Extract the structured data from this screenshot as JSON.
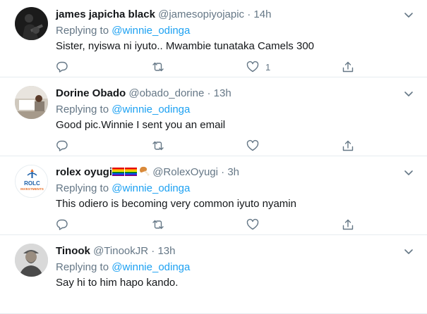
{
  "tweets": [
    {
      "name": "james japicha black",
      "handle": "@jamesopiyojapic",
      "separator": "·",
      "time": "14h",
      "replying_prefix": "Replying to",
      "replying_to": "@winnie_odinga",
      "text": "Sister, nyiswa ni iyuto.. Mwambie tunataka Camels 300",
      "like_count": "1",
      "avatar": "dark-guitar-photo"
    },
    {
      "name": "Dorine Obado",
      "handle": "@obado_dorine",
      "separator": "·",
      "time": "13h",
      "replying_prefix": "Replying to",
      "replying_to": "@winnie_odinga",
      "text": "Good pic.Winnie I sent you an email",
      "like_count": "",
      "avatar": "office-photo"
    },
    {
      "name": "rolex oyugi",
      "handle": "@RolexOyugi",
      "separator": "·",
      "time": "3h",
      "replying_prefix": "Replying to",
      "replying_to": "@winnie_odinga",
      "text": "This odiero is becoming very common iyuto nyamin",
      "like_count": "",
      "avatar": "rolc-logo",
      "avatar_text": [
        "ROLC",
        "INVESTMENTS"
      ]
    },
    {
      "name": "Tinook",
      "handle": "@TinookJR",
      "separator": "·",
      "time": "13h",
      "replying_prefix": "Replying to",
      "replying_to": "@winnie_odinga",
      "text": "Say hi to him hapo kando.",
      "like_count": "",
      "avatar": "man-portrait-photo"
    }
  ],
  "icons": {
    "reply": "reply-icon",
    "retweet": "retweet-icon",
    "like": "heart-icon",
    "share": "share-icon",
    "more": "chevron-down-icon"
  },
  "colors": {
    "link": "#1da1f2",
    "secondary_text": "#657786",
    "primary_text": "#14171a",
    "divider": "#e6ecf0"
  }
}
